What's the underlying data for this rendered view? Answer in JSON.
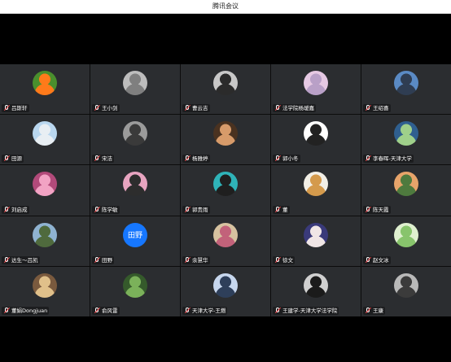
{
  "app": {
    "title": "腾讯会议"
  },
  "participants": [
    {
      "name": "吕斯轩",
      "avatar": "clownfish-avatar",
      "bg": "#4a8f2d",
      "fg": "#ff7a1a"
    },
    {
      "name": "王小剑",
      "avatar": "sketch-portrait-avatar",
      "bg": "#bdbdbd",
      "fg": "#7f7f7f"
    },
    {
      "name": "曹云吉",
      "avatar": "person-photo-avatar",
      "bg": "#c8c8c8",
      "fg": "#2b2b2b"
    },
    {
      "name": "法学院杨瑷嘉",
      "avatar": "pink-pattern-avatar",
      "bg": "#e6c9e3",
      "fg": "#b9a0c7"
    },
    {
      "name": "王绍喜",
      "avatar": "city-skyline-avatar",
      "bg": "#5a8ac4",
      "fg": "#2f3d52"
    },
    {
      "name": "田源",
      "avatar": "sky-landscape-avatar",
      "bg": "#b9d7ef",
      "fg": "#e8eef3"
    },
    {
      "name": "宋洁",
      "avatar": "standing-person-avatar",
      "bg": "#9b9b9b",
      "fg": "#3a3a3a"
    },
    {
      "name": "杨雅婷",
      "avatar": "portrait-avatar",
      "bg": "#4a3220",
      "fg": "#d79b6a"
    },
    {
      "name": "郭小冬",
      "avatar": "cartoon-avatar",
      "bg": "#ffffff",
      "fg": "#222222"
    },
    {
      "name": "李春晖-天津大学",
      "avatar": "earth-globe-avatar",
      "bg": "#2f5f8f",
      "fg": "#9fd08a"
    },
    {
      "name": "刘启成",
      "avatar": "pink-flowers-avatar",
      "bg": "#b24a7a",
      "fg": "#f2a3c4"
    },
    {
      "name": "陈学敏",
      "avatar": "person-outdoor-avatar",
      "bg": "#e7a4c0",
      "fg": "#2d2d2d"
    },
    {
      "name": "郭贵雨",
      "avatar": "anime-avatar",
      "bg": "#2fb3b8",
      "fg": "#1f1f1f"
    },
    {
      "name": "董",
      "avatar": "anime-girl-avatar",
      "bg": "#f2efe6",
      "fg": "#d49a4c"
    },
    {
      "name": "陈天霞",
      "avatar": "sunset-landscape-avatar",
      "bg": "#e7a46a",
      "fg": "#4e7a3e"
    },
    {
      "name": "达生～吕凯",
      "avatar": "mountain-landscape-avatar",
      "bg": "#8fb3d1",
      "fg": "#4f6a3d"
    },
    {
      "name": "田野",
      "avatar": "text-avatar",
      "initials": "田野",
      "bg": "#1677ff",
      "fg": "#ffffff"
    },
    {
      "name": "余慧华",
      "avatar": "flower-avatar",
      "bg": "#d7c2a0",
      "fg": "#c2627a"
    },
    {
      "name": "徐文",
      "avatar": "anime-character-avatar",
      "bg": "#3a3a7a",
      "fg": "#f0e6e6"
    },
    {
      "name": "赵文冰",
      "avatar": "cartoon-green-avatar",
      "bg": "#dff0cf",
      "fg": "#88c46c"
    },
    {
      "name": "董娟Dongjuan",
      "avatar": "group-photo-avatar",
      "bg": "#7a5a3e",
      "fg": "#e0c08a"
    },
    {
      "name": "俞风雷",
      "avatar": "tree-photo-avatar",
      "bg": "#355a2b",
      "fg": "#7bb15a"
    },
    {
      "name": "天津大学-王燃",
      "avatar": "person-blue-avatar",
      "bg": "#c7d7ee",
      "fg": "#2e3f5a"
    },
    {
      "name": "王建学-天津大学法学院",
      "avatar": "man-portrait-avatar",
      "bg": "#d0d0d0",
      "fg": "#1b1b1b"
    },
    {
      "name": "王康",
      "avatar": "man-standing-avatar",
      "bg": "#b9b9b9",
      "fg": "#3b3b3b"
    }
  ],
  "colors": {
    "tile_bg": "#2b2d30",
    "muted_mic": "#ff4d4f",
    "text_avatar_bg": "#1677ff"
  }
}
